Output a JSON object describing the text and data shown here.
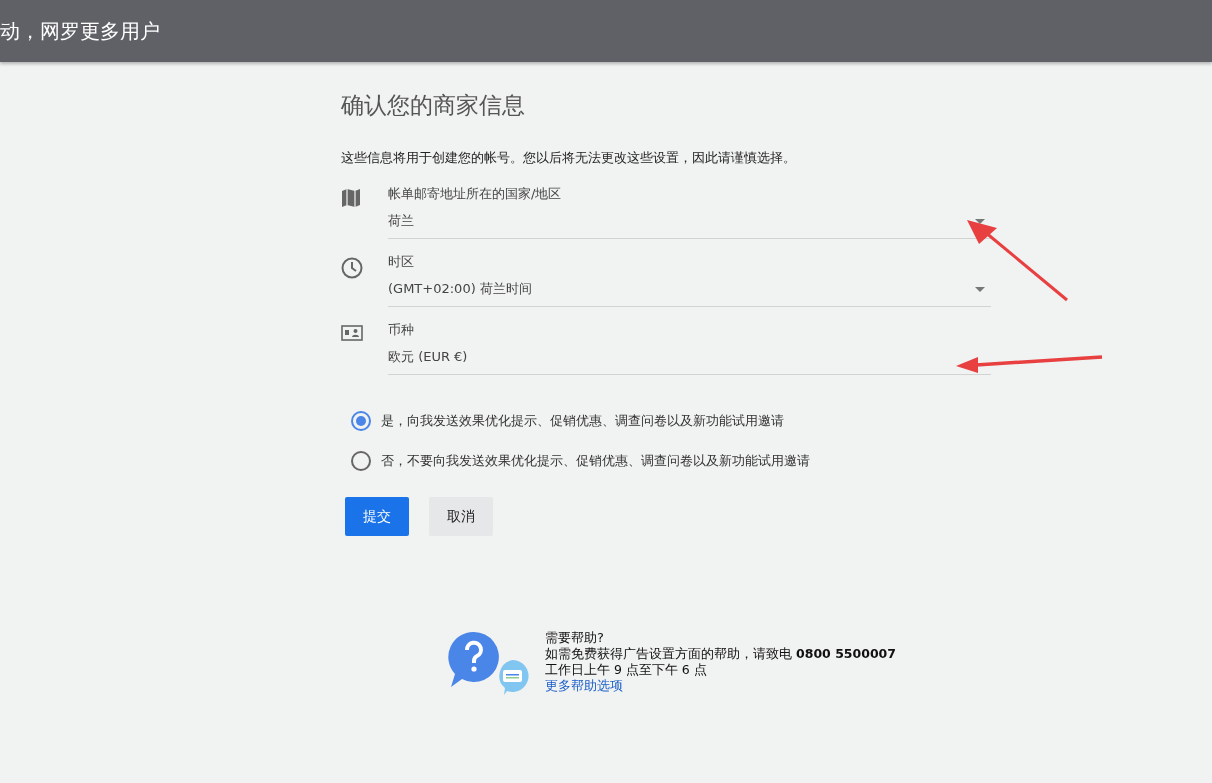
{
  "header": {
    "title": "动，网罗更多用户"
  },
  "page": {
    "title": "确认您的商家信息",
    "intro": "这些信息将用于创建您的帐号。您以后将无法更改这些设置，因此请谨慎选择。"
  },
  "fields": [
    {
      "kind": "map",
      "label": "帐单邮寄地址所在的国家/地区",
      "value": "荷兰",
      "dropdown": true
    },
    {
      "kind": "clock",
      "label": "时区",
      "value": "(GMT+02:00) 荷兰时间",
      "dropdown": true
    },
    {
      "kind": "currency",
      "label": "币种",
      "value": "欧元 (EUR €)",
      "dropdown": false
    }
  ],
  "options": [
    {
      "label": "是，向我发送效果优化提示、促销优惠、调查问卷以及新功能试用邀请",
      "selected": true
    },
    {
      "label": "否，不要向我发送效果优化提示、促销优惠、调查问卷以及新功能试用邀请",
      "selected": false
    }
  ],
  "buttons": [
    {
      "label": "提交",
      "kind": "primary"
    },
    {
      "label": "取消",
      "kind": "secondary"
    }
  ],
  "help": {
    "title": "需要帮助?",
    "text": "如需免费获得广告设置方面的帮助，请致电 **0800 5500007**",
    "hours": "工作日上午 9 点至下午 6 点",
    "link": "更多帮助选项"
  }
}
